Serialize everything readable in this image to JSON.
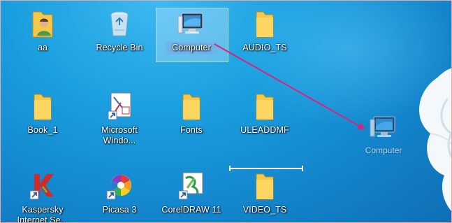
{
  "desktop": {
    "icons": [
      {
        "label": "aa",
        "icon": "user-folder-icon"
      },
      {
        "label": "Recycle Bin",
        "icon": "recycle-bin-icon"
      },
      {
        "label": "Computer",
        "icon": "computer-icon",
        "selected": true
      },
      {
        "label": "AUDIO_TS",
        "icon": "folder-icon"
      },
      {
        "label": "Book_1",
        "icon": "folder-icon"
      },
      {
        "label": "Microsoft Windo...",
        "icon": "shortcut-app-icon"
      },
      {
        "label": "Fonts",
        "icon": "folder-icon"
      },
      {
        "label": "ULEADDMF",
        "icon": "folder-icon"
      },
      {
        "label": "Kaspersky Internet Se...",
        "icon": "kaspersky-icon"
      },
      {
        "label": "Picasa 3",
        "icon": "picasa-icon"
      },
      {
        "label": "CorelDRAW 11",
        "icon": "coreldraw-icon"
      },
      {
        "label": "VIDEO_TS",
        "icon": "folder-icon"
      }
    ],
    "drag_ghost": {
      "label": "Computer",
      "icon": "computer-icon"
    },
    "colors": {
      "arrow": "#e0207a",
      "desktop": "#1a9fe0",
      "folder": "#f5c84a"
    }
  }
}
